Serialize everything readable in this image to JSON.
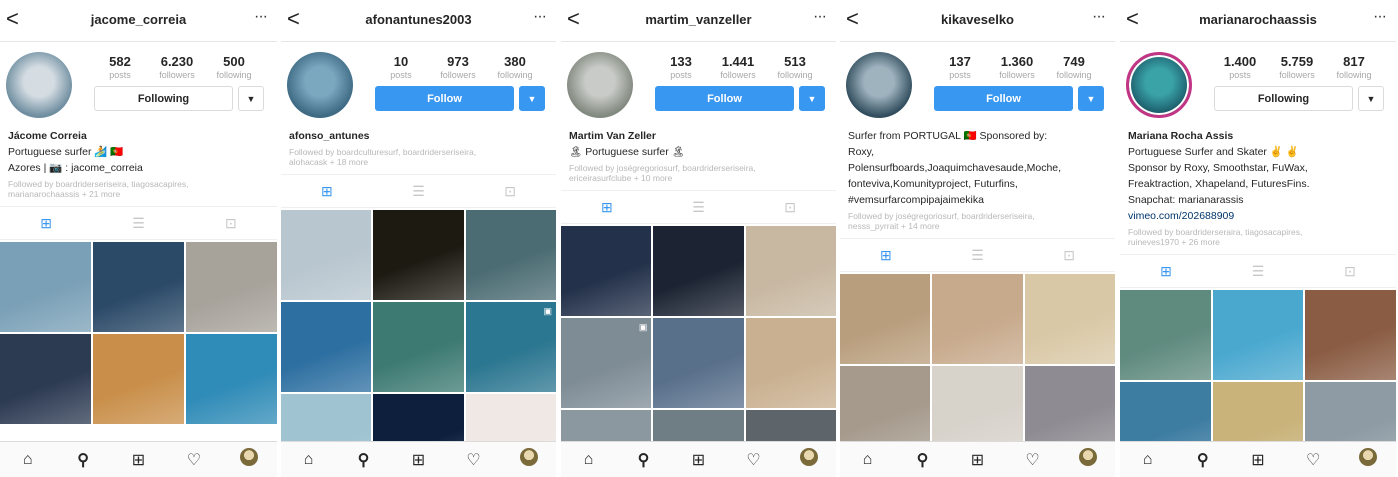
{
  "ui": {
    "back": "<",
    "more": "···",
    "tab_grid": "⊞",
    "tab_list": "☰",
    "tab_tagged": "⊡",
    "nav_home": "⌂",
    "nav_search": "⚲",
    "nav_add": "⊞",
    "nav_activity": "♡",
    "caret": "▼"
  },
  "labels": {
    "posts": "posts",
    "followers": "followers",
    "following": "following"
  },
  "profiles": [
    {
      "username": "jacome_correia",
      "posts": "582",
      "followers": "6.230",
      "following": "500",
      "button": "Following",
      "button_type": "following",
      "bio": [
        "Jácome Correia",
        "Portuguese surfer 🏄 🇵🇹",
        "Azores | 📷 : jacome_correia"
      ],
      "link": "",
      "followed_by": [
        "Followed by boardriderseriseira, tiagosacapires,",
        "marianarochaassis + 21 more"
      ],
      "avatar_colors": [
        "#d5dde3",
        "#6f8ea0"
      ],
      "tiles": [
        "#7aa0b7",
        "#2b4a68",
        "#a7a29a",
        "#2c3a52",
        "#c98f4a",
        "#2f8bb7"
      ],
      "tile_icons": [
        "",
        "",
        "",
        "",
        "",
        ""
      ]
    },
    {
      "username": "afonantunes2003",
      "posts": "10",
      "followers": "973",
      "following": "380",
      "button": "Follow",
      "button_type": "follow",
      "bio": [
        "afonso_antunes"
      ],
      "link": "",
      "followed_by": [
        "Followed by boardculturesurf, boardriderseriseira,",
        "alohacask + 18 more"
      ],
      "avatar_colors": [
        "#7ba7bf",
        "#3e6a84"
      ],
      "tiles": [
        "#b8c6cf",
        "#1d1a12",
        "#4b6c73",
        "#2d6fa1",
        "#3c7a72",
        "#2b7690",
        "#9fc3d1",
        "#0d1f3d",
        "#efe8e4"
      ],
      "tile_icons": [
        "",
        "",
        "",
        "",
        "",
        "▣",
        "",
        "",
        "FREEDOMF"
      ]
    },
    {
      "username": "martim_vanzeller",
      "posts": "133",
      "followers": "1.441",
      "following": "513",
      "button": "Follow",
      "button_type": "follow",
      "bio": [
        "Martim Van Zeller",
        "🏝 Portuguese surfer 🏝"
      ],
      "link": "",
      "followed_by": [
        "Followed by joségregoriosurf, boardriderseriseira,",
        "ericeirasurfclube + 10 more"
      ],
      "avatar_colors": [
        "#c8cbc7",
        "#82897f"
      ],
      "tiles": [
        "#23314a",
        "#1c2433",
        "#c8b8a2",
        "#7e8c96",
        "#59708b",
        "#c9b090",
        "#8b98a0",
        "#6f7d84",
        "#5d646a"
      ],
      "tile_icons": [
        "",
        "",
        "",
        "▣",
        "",
        "",
        "",
        "",
        ""
      ]
    },
    {
      "username": "kikaveselko",
      "posts": "137",
      "followers": "1.360",
      "following": "749",
      "button": "Follow",
      "button_type": "follow",
      "bio": [
        "Surfer from PORTUGAL 🇵🇹 Sponsored by:",
        "Roxy,",
        "Polensurfboards,Joaquimchavesaude,Moche,",
        "fonteviva,Komunityproject, Futurfins,",
        "#vemsurfarcompipajaimekika"
      ],
      "link": "",
      "followed_by": [
        "Followed by joségregoriosurf, boardriderseriseira,",
        "nesss_pyrrait + 14 more"
      ],
      "avatar_colors": [
        "#9fb3bf",
        "#324e5e"
      ],
      "tiles": [
        "#b99e7d",
        "#c7a98b",
        "#d9c8a6",
        "#a59a8c",
        "#d7d2ca",
        "#8e8b92"
      ],
      "tile_icons": [
        "",
        "",
        "",
        "",
        "",
        ""
      ]
    },
    {
      "username": "marianarochaassis",
      "posts": "1.400",
      "followers": "5.759",
      "following": "817",
      "button": "Following",
      "button_type": "following",
      "bio": [
        "Mariana Rocha Assis",
        "Portuguese Surfer and Skater ✌ ✌",
        "Sponsor by Roxy, Smoothstar, FuWax,",
        "Freaktraction, Xhapeland, FuturesFins.",
        "Snapchat: marianarassis"
      ],
      "link": "vimeo.com/202688909",
      "followed_by": [
        "Followed by boardriderseraira, tiagosacapires,",
        "ruineves1970 + 26 more"
      ],
      "avatar_colors": [
        "#3aa3a8",
        "#1c5c6a"
      ],
      "tiles": [
        "#5f8a7e",
        "#4aa8cf",
        "#8a5c43",
        "#3e7da2",
        "#c9b37a",
        "#8e9ba4"
      ],
      "tile_icons": [
        "",
        "",
        "",
        "",
        "",
        ""
      ]
    }
  ]
}
